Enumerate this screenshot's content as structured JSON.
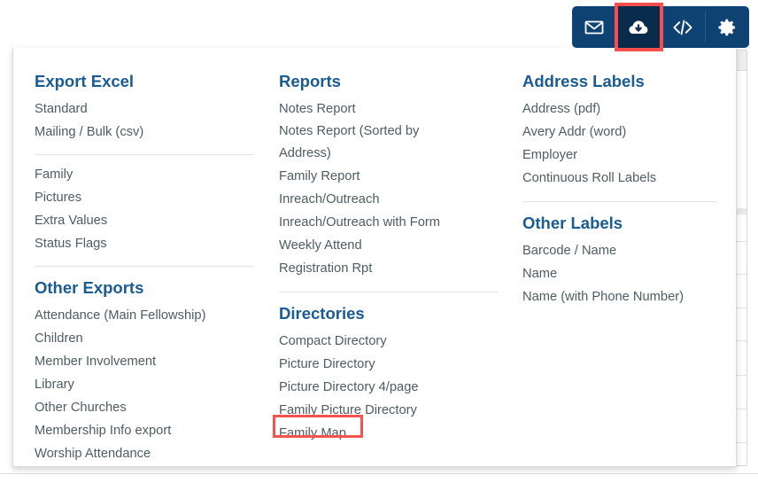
{
  "toolbar": {
    "buttons": [
      {
        "name": "email-icon",
        "label": "Email",
        "icon": "envelope-icon",
        "active": false
      },
      {
        "name": "export-icon",
        "label": "Export / Download",
        "icon": "cloud-download-icon",
        "active": true
      },
      {
        "name": "code-icon",
        "label": "Code",
        "icon": "code-brackets-icon",
        "active": false
      },
      {
        "name": "settings-icon",
        "label": "Settings",
        "icon": "gear-icon",
        "active": false
      }
    ],
    "background_color": "#0e4273",
    "active_background_color": "#0a2c4c",
    "highlight_color": "#fc4d4d"
  },
  "dropdown": {
    "highlight_color": "#f4534f",
    "highlighted_item": "Family Map",
    "columns": {
      "left": {
        "groups": [
          {
            "title": "Export Excel",
            "items": [
              "Standard",
              "Mailing / Bulk (csv)"
            ]
          },
          {
            "title": "",
            "items": [
              "Family",
              "Pictures",
              "Extra Values",
              "Status Flags"
            ]
          },
          {
            "title": "Other Exports",
            "items": [
              "Attendance (Main Fellowship)",
              "Children",
              "Member Involvement",
              "Library",
              "Other Churches",
              "Membership Info export",
              "Worship Attendance"
            ]
          }
        ]
      },
      "middle": {
        "groups": [
          {
            "title": "Reports",
            "items": [
              "Notes Report",
              "Notes Report (Sorted by Address)",
              "Family Report",
              "Inreach/Outreach",
              "Inreach/Outreach with Form",
              "Weekly Attend",
              "Registration Rpt"
            ]
          },
          {
            "title": "Directories",
            "items": [
              "Compact Directory",
              "Picture Directory",
              "Picture Directory 4/page",
              "Family Picture Directory",
              "Family Map"
            ]
          }
        ]
      },
      "right": {
        "groups": [
          {
            "title": "Address Labels",
            "items": [
              "Address (pdf)",
              "Avery Addr (word)",
              "Employer",
              "Continuous Roll Labels"
            ]
          },
          {
            "title": "Other Labels",
            "items": [
              "Barcode / Name",
              "Name",
              "Name (with Phone Number)"
            ]
          }
        ]
      }
    }
  },
  "colors": {
    "heading": "#1a5b92",
    "item_text": "#4e5c63",
    "panel_background": "#ffffff",
    "divider": "#e4e4e4"
  }
}
